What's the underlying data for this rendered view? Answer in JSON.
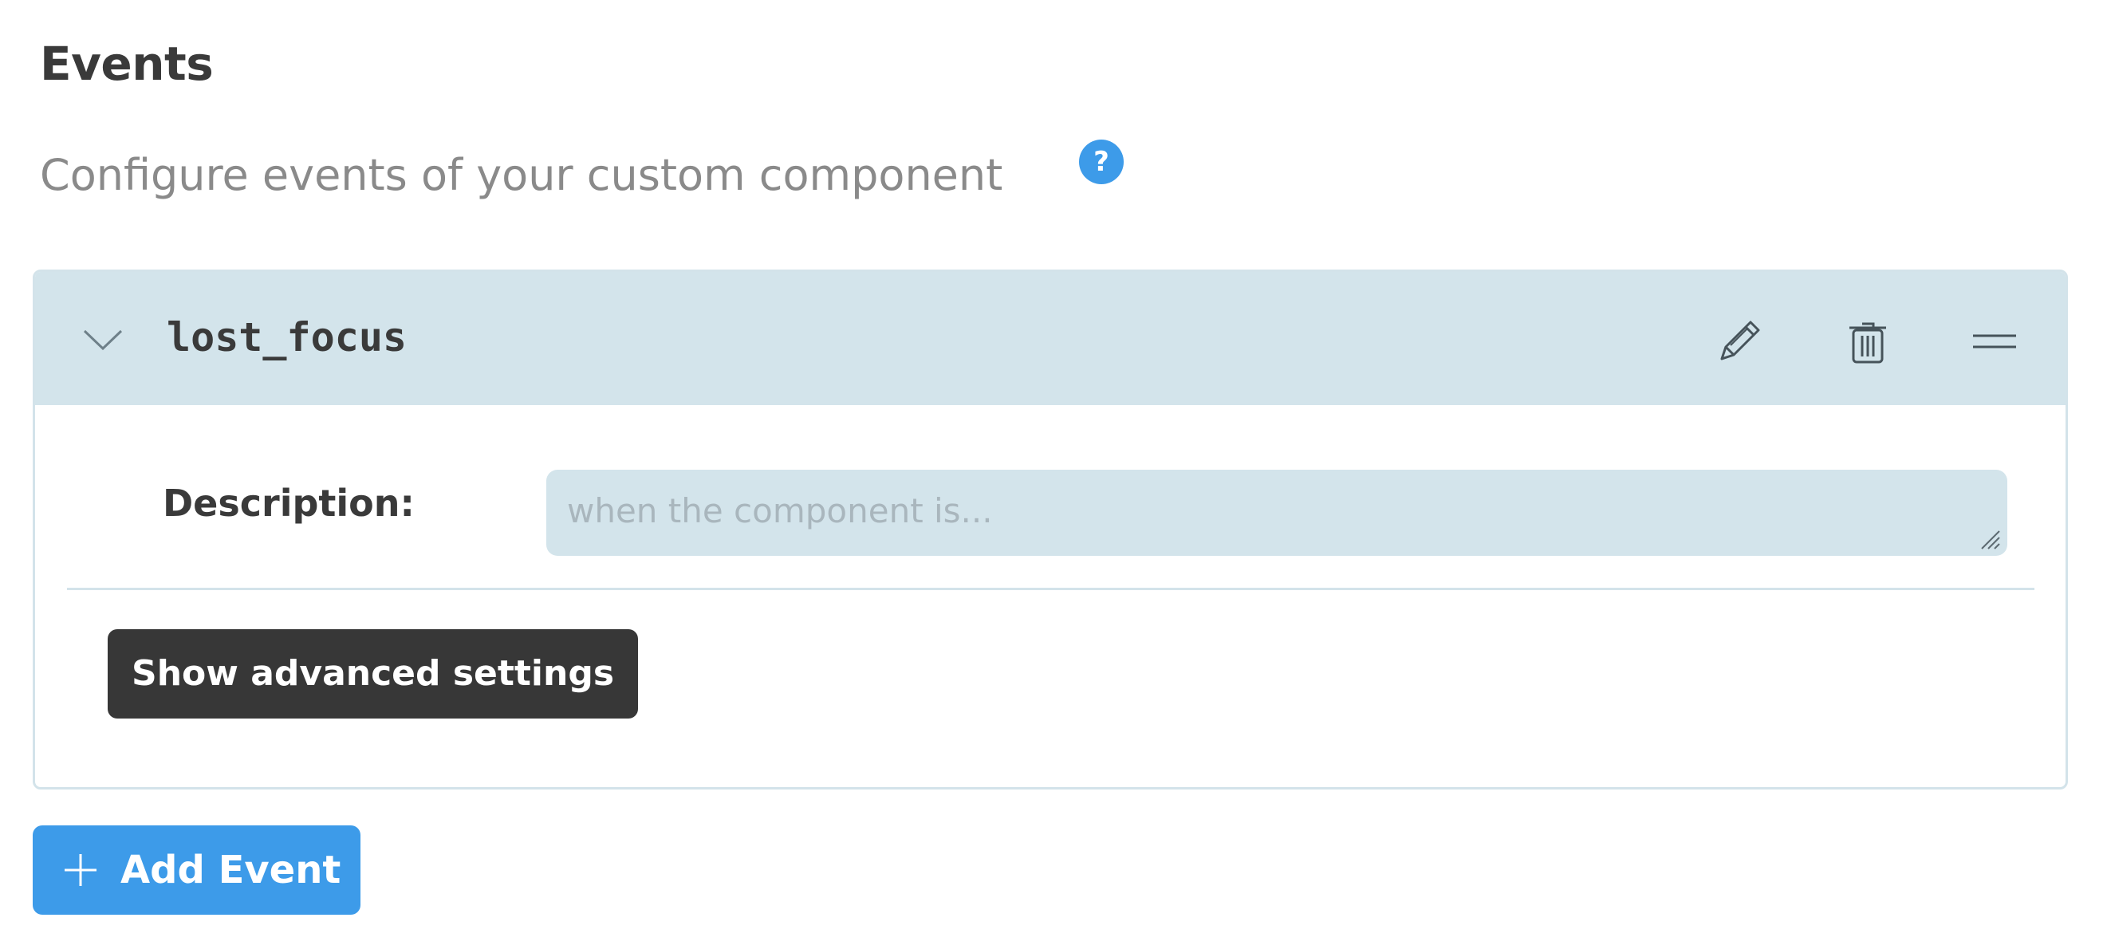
{
  "header": {
    "title": "Events",
    "subtitle": "Configure events of your custom component",
    "help_icon": "?"
  },
  "event": {
    "name": "lost_focus",
    "description_label": "Description:",
    "description_value": "",
    "description_placeholder": "when the component is...",
    "advanced_button_label": "Show advanced settings",
    "icons": {
      "collapse": "chevron-down-icon",
      "edit": "pencil-icon",
      "delete": "trash-icon",
      "drag": "drag-handle-icon"
    }
  },
  "actions": {
    "add_event_label": "Add Event"
  },
  "colors": {
    "accent": "#3d9be9",
    "header_background": "#d3e4eb",
    "dark_button": "#373737"
  }
}
